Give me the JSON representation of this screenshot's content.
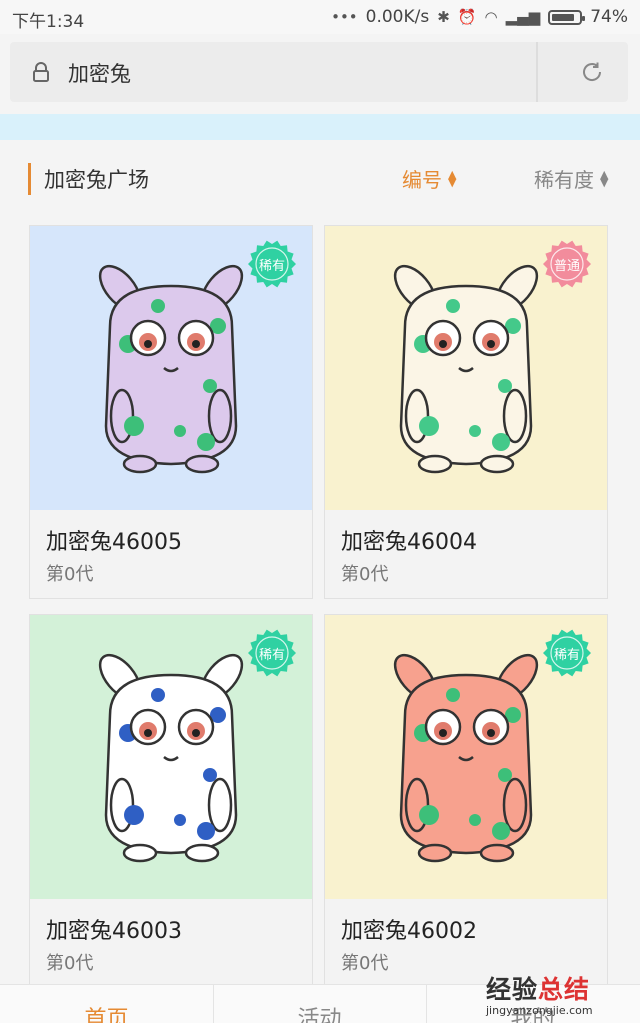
{
  "status_bar": {
    "time": "下午1:34",
    "network_speed": "0.00K/s",
    "battery": "74%"
  },
  "url_bar": {
    "title": "加密兔"
  },
  "section": {
    "title": "加密兔广场",
    "sort_number": "编号",
    "sort_rarity": "稀有度"
  },
  "cards": [
    {
      "name": "加密兔46005",
      "generation": "第0代",
      "rarity": "稀有",
      "background": "#d6e6fb",
      "body_color": "#dcc9ec",
      "spot_color": "#3dbf79",
      "rarity_color": "#2fd1a2"
    },
    {
      "name": "加密兔46004",
      "generation": "第0代",
      "rarity": "普通",
      "background": "#f9f2cf",
      "body_color": "#fbf5e6",
      "spot_color": "#44c98a",
      "rarity_color": "#f28c9c"
    },
    {
      "name": "加密兔46003",
      "generation": "第0代",
      "rarity": "稀有",
      "background": "#d3f1d8",
      "body_color": "#ffffff",
      "spot_color": "#2f5fc4",
      "rarity_color": "#2fd1a2"
    },
    {
      "name": "加密兔46002",
      "generation": "第0代",
      "rarity": "稀有",
      "background": "#f9f2cf",
      "body_color": "#f7a18e",
      "spot_color": "#3dbf79",
      "rarity_color": "#2fd1a2"
    }
  ],
  "bottom_nav": {
    "home": "首页",
    "activity": "活动",
    "mine": "我的"
  },
  "watermark": {
    "text_black": "经验",
    "text_red": "总结",
    "url": "jingyanzongjie.com"
  },
  "colors": {
    "accent": "#e58a33",
    "banner": "#d9f1fb"
  }
}
